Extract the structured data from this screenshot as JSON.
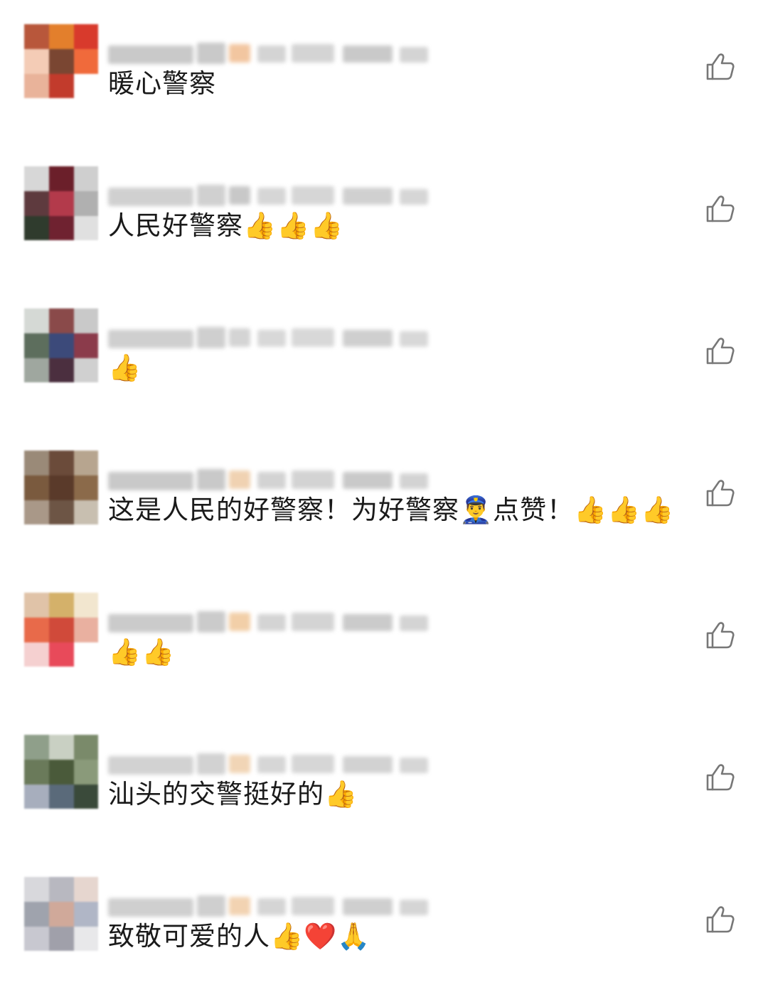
{
  "comments": [
    {
      "text": "暖心警察",
      "avatar_colors": [
        "#b8573b",
        "#e37f2c",
        "#d83a2c",
        "#f4ccb6",
        "#7a4632",
        "#f06a3b",
        "#e9b39a",
        "#c23b2c",
        "#ffffff"
      ],
      "meta_colors": [
        "#c9c9c9",
        "#f2c6a0",
        "#d4d4d4"
      ],
      "like_icon": "thumbs-up-outline-icon"
    },
    {
      "text": "人民好警察👍👍👍",
      "avatar_colors": [
        "#d7d7d7",
        "#6b1f2a",
        "#cfcfcf",
        "#5e3a3e",
        "#b33a4b",
        "#b0b0b0",
        "#2f3b2d",
        "#6f2230",
        "#e0e0e0"
      ],
      "meta_colors": [
        "#d0d0d0",
        "#c8c8c8",
        "#d6d6d6"
      ],
      "like_icon": "thumbs-up-outline-icon"
    },
    {
      "text": "👍",
      "avatar_colors": [
        "#d5d9d5",
        "#8a4a4a",
        "#c9c9c9",
        "#5d6e5d",
        "#3c4a7a",
        "#8b3b4b",
        "#9fa79f",
        "#4b2f3f",
        "#d0d0d0"
      ],
      "meta_colors": [
        "#cfcfcf",
        "#d4d4d4",
        "#d8d8d8"
      ],
      "like_icon": "thumbs-up-outline-icon"
    },
    {
      "text": "这是人民的好警察！为好警察👮‍♂️点赞！👍👍👍",
      "avatar_colors": [
        "#9a8a78",
        "#6b4b3a",
        "#b7a58f",
        "#7a5a3e",
        "#5a3a2a",
        "#8b6a4a",
        "#a99888",
        "#6d5545",
        "#c8bfb0"
      ],
      "meta_colors": [
        "#c9c9c9",
        "#f0d2b2",
        "#d3d3d3"
      ],
      "like_icon": "thumbs-up-outline-icon"
    },
    {
      "text": "👍👍",
      "avatar_colors": [
        "#e0c3a8",
        "#d4b16a",
        "#f2e6cf",
        "#e86a4a",
        "#d04a3a",
        "#e9b0a0",
        "#f5d0d0",
        "#e84a5a",
        "#ffffff"
      ],
      "meta_colors": [
        "#cbcbcb",
        "#f2cfa8",
        "#d4d4d4"
      ],
      "like_icon": "thumbs-up-outline-icon"
    },
    {
      "text": "汕头的交警挺好的👍",
      "avatar_colors": [
        "#8f9f8a",
        "#c9d0c3",
        "#7a8a6a",
        "#6a7a5a",
        "#4a5a3a",
        "#8a9a7a",
        "#a7aebd",
        "#5a6a7a",
        "#3a4a3a"
      ],
      "meta_colors": [
        "#d2d2d2",
        "#f1d5b6",
        "#d6d6d6"
      ],
      "like_icon": "thumbs-up-outline-icon"
    },
    {
      "text": "致敬可爱的人👍❤️🙏",
      "avatar_colors": [
        "#d8d8dc",
        "#b8b8c0",
        "#e6d6cf",
        "#9fa3ad",
        "#d0a99a",
        "#b0b6c6",
        "#c8c8d0",
        "#a0a0aa",
        "#e8e8ea"
      ],
      "meta_colors": [
        "#cfcfcf",
        "#f2d3b2",
        "#d5d5d5"
      ],
      "like_icon": "thumbs-up-outline-icon"
    }
  ]
}
